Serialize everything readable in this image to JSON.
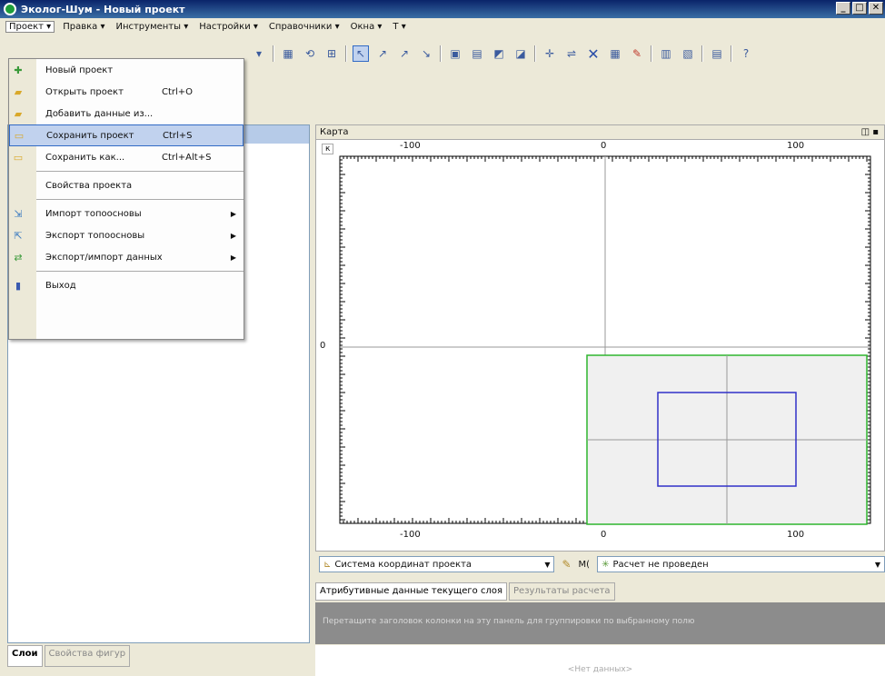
{
  "window": {
    "title": "Эколог-Шум - Новый проект",
    "controls": [
      "_",
      "□",
      "✕"
    ]
  },
  "menubar": [
    {
      "label": "Проект ▾"
    },
    {
      "label": "Правка ▾"
    },
    {
      "label": "Инструменты ▾"
    },
    {
      "label": "Настройки ▾"
    },
    {
      "label": "Справочники ▾"
    },
    {
      "label": "Окна ▾"
    },
    {
      "label": "Т ▾"
    }
  ],
  "dropdown": {
    "items": [
      {
        "label": "Новый проект",
        "shortcut": "",
        "icon": "new-project-icon"
      },
      {
        "label": "Открыть проект",
        "shortcut": "Ctrl+O",
        "icon": "open-folder-icon"
      },
      {
        "label": "Добавить данные из...",
        "shortcut": "",
        "icon": "add-data-icon"
      },
      {
        "label": "Сохранить проект",
        "shortcut": "Ctrl+S",
        "icon": "save-icon"
      },
      {
        "label": "Сохранить как...",
        "shortcut": "Ctrl+Alt+S",
        "icon": "save-as-icon"
      },
      {
        "label": "Свойства проекта",
        "shortcut": "",
        "icon": ""
      },
      {
        "label": "Импорт топоосновы",
        "shortcut": "",
        "icon": "import-icon"
      },
      {
        "label": "Экспорт топоосновы",
        "shortcut": "",
        "icon": "export-icon"
      },
      {
        "label": "Экспорт/импорт данных",
        "shortcut": "",
        "icon": "exchange-icon"
      },
      {
        "label": "Выход",
        "shortcut": "",
        "icon": "exit-icon"
      }
    ]
  },
  "map": {
    "title": "Карта",
    "top_ticks": [
      "-100",
      "0",
      "100"
    ],
    "bottom_ticks": [
      "-100",
      "0",
      "100"
    ],
    "left_tick": "0",
    "corner": "к"
  },
  "statusbar": {
    "coord_system": "Система координат проекта",
    "zoom_label": "М(",
    "calc_status": "Расчет не проведен"
  },
  "bottom_tabs": [
    "Атрибутивные данные текущего слоя",
    "Результаты расчета"
  ],
  "group_hint": "Перетащите заголовок колонки на эту панель для группировки по выбранному полю",
  "no_data": "<Нет данных>",
  "left_tabs": [
    "Слои",
    "Свойства фигур"
  ],
  "colors": {
    "selection": "#c1d2ee",
    "green_rect": "#2fb52f",
    "blue_rect": "#3030c8"
  }
}
